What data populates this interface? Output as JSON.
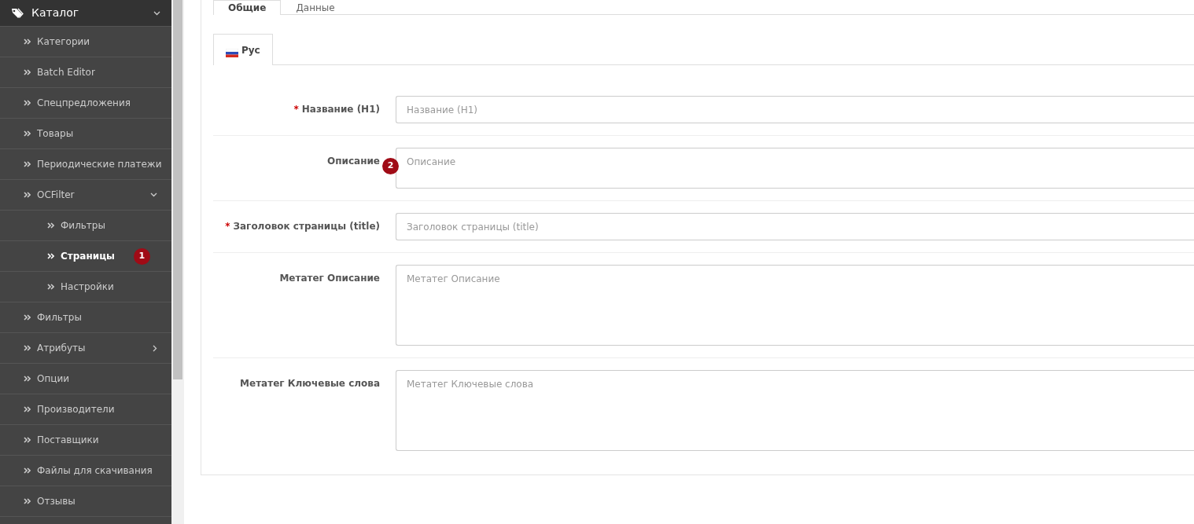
{
  "sidebar": {
    "header": {
      "label": "Каталог",
      "expanded": true
    },
    "items": [
      {
        "label": "Категории",
        "selected": false
      },
      {
        "label": "Batch Editor",
        "selected": false
      },
      {
        "label": "Спецпредложения",
        "selected": false
      },
      {
        "label": "Товары",
        "selected": false
      },
      {
        "label": "Периодические платежи",
        "selected": false
      },
      {
        "label": "OCFilter",
        "selected": false,
        "expanded": true,
        "children": [
          {
            "label": "Фильтры",
            "selected": false
          },
          {
            "label": "Страницы",
            "selected": true,
            "badge": "1"
          },
          {
            "label": "Настройки",
            "selected": false
          }
        ]
      },
      {
        "label": "Фильтры",
        "selected": false
      },
      {
        "label": "Атрибуты",
        "selected": false,
        "expanded": false
      },
      {
        "label": "Опции",
        "selected": false
      },
      {
        "label": "Производители",
        "selected": false
      },
      {
        "label": "Поставщики",
        "selected": false
      },
      {
        "label": "Файлы для скачивания",
        "selected": false
      },
      {
        "label": "Отзывы",
        "selected": false
      }
    ]
  },
  "tabs": [
    {
      "label": "Общие",
      "selected": true
    },
    {
      "label": "Данные",
      "selected": false
    }
  ],
  "language_tabs": [
    {
      "label": "Рус",
      "selected": true
    }
  ],
  "fields": [
    {
      "label": "Название (H1)",
      "asterisk": "*",
      "kind": "input",
      "placeholder": "Название (H1)"
    },
    {
      "label": "Описание",
      "kind": "short",
      "placeholder": "Описание",
      "badge": "2"
    },
    {
      "label": "Заголовок страницы (title)",
      "asterisk": "*",
      "kind": "input",
      "placeholder": "Заголовок страницы (title)"
    },
    {
      "label": "Метатег Описание",
      "kind": "tall",
      "placeholder": "Метатег Описание"
    },
    {
      "label": "Метатег Ключевые слова",
      "kind": "tall",
      "placeholder": "Метатег Ключевые слова"
    }
  ]
}
